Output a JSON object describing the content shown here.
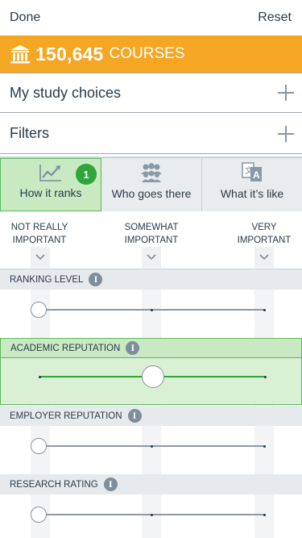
{
  "topbar": {
    "done_label": "Done",
    "reset_label": "Reset"
  },
  "banner": {
    "count": "150,645",
    "unit": "COURSES"
  },
  "rows": {
    "study_choices": "My study choices",
    "filters": "Filters"
  },
  "tabs": [
    {
      "label": "How it ranks",
      "badge": "1",
      "active": true
    },
    {
      "label": "Who goes there"
    },
    {
      "label": "What it’s like"
    }
  ],
  "scale": {
    "low": [
      "Not really",
      "important"
    ],
    "mid": [
      "Somewhat",
      "important"
    ],
    "high": [
      "Very",
      "important"
    ]
  },
  "sections": [
    {
      "label": "Ranking level",
      "level": 0
    },
    {
      "label": "Academic reputation",
      "level": 0.5,
      "active": true
    },
    {
      "label": "Employer reputation",
      "level": 0
    },
    {
      "label": "Research rating",
      "level": 0
    }
  ],
  "colors": {
    "accent_orange": "#f5a623",
    "active_green": "#2fa53a",
    "active_bg": "#c8e9c2"
  },
  "icons": [
    "building-icon",
    "plus-icon",
    "line-chart-icon",
    "people-icon",
    "translate-icon",
    "chevron-down-icon",
    "info-icon"
  ]
}
